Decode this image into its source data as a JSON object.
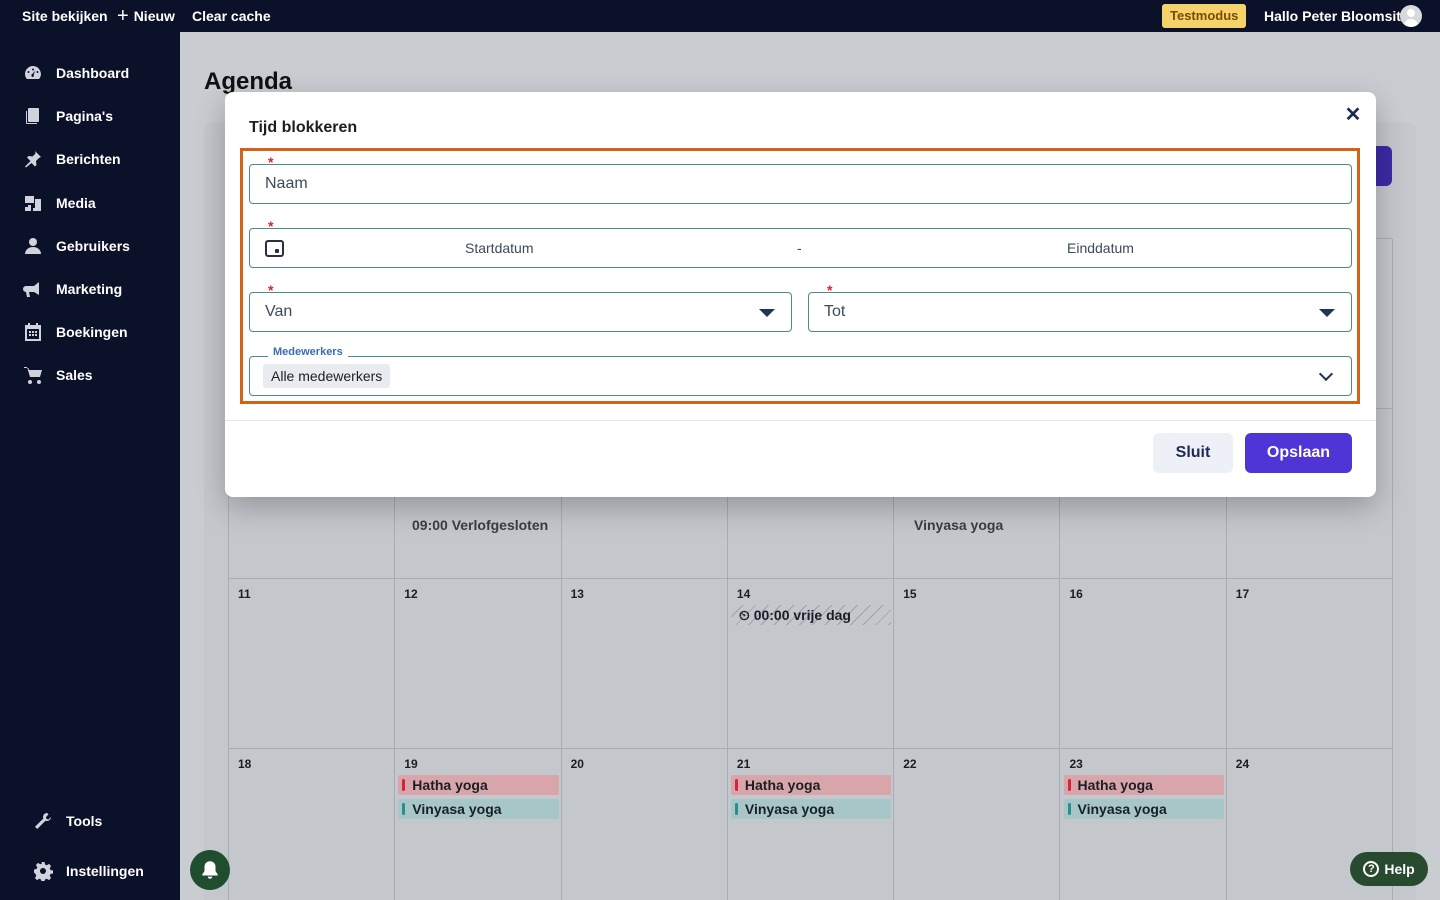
{
  "topbar": {
    "site_label": "Site bekijken",
    "new_label": "Nieuw",
    "cache_label": "Clear cache",
    "mode_badge": "Testmodus",
    "greeting": "Hallo Peter Bloomsite"
  },
  "sidebar": {
    "items": [
      {
        "label": "Dashboard",
        "icon": "dashboard-icon"
      },
      {
        "label": "Pagina's",
        "icon": "pages-icon"
      },
      {
        "label": "Berichten",
        "icon": "pin-icon"
      },
      {
        "label": "Media",
        "icon": "media-icon"
      },
      {
        "label": "Gebruikers",
        "icon": "user-icon"
      },
      {
        "label": "Marketing",
        "icon": "megaphone-icon"
      },
      {
        "label": "Boekingen",
        "icon": "calendar-icon"
      },
      {
        "label": "Sales",
        "icon": "cart-icon"
      }
    ],
    "bottom": [
      {
        "label": "Tools",
        "icon": "wrench-icon"
      },
      {
        "label": "Instellingen",
        "icon": "gear-icon"
      }
    ]
  },
  "page": {
    "title": "Agenda"
  },
  "calendar": {
    "week2": [
      {
        "day": "11",
        "events": []
      },
      {
        "day": "12",
        "events": []
      },
      {
        "day": "13",
        "events": []
      },
      {
        "day": "14",
        "events": [
          {
            "label": "⏲ 00:00 vrije dag",
            "type": "free"
          }
        ]
      },
      {
        "day": "15",
        "events": []
      },
      {
        "day": "16",
        "events": []
      },
      {
        "day": "17",
        "events": []
      }
    ],
    "week3": [
      {
        "day": "18",
        "events": []
      },
      {
        "day": "19",
        "events": [
          {
            "label": "Hatha yoga",
            "type": "hatha"
          },
          {
            "label": "Vinyasa yoga",
            "type": "vinyasa"
          }
        ]
      },
      {
        "day": "20",
        "events": []
      },
      {
        "day": "21",
        "events": [
          {
            "label": "Hatha yoga",
            "type": "hatha"
          },
          {
            "label": "Vinyasa yoga",
            "type": "vinyasa"
          }
        ]
      },
      {
        "day": "22",
        "events": []
      },
      {
        "day": "23",
        "events": [
          {
            "label": "Hatha yoga",
            "type": "hatha"
          },
          {
            "label": "Vinyasa yoga",
            "type": "vinyasa"
          }
        ]
      },
      {
        "day": "24",
        "events": []
      }
    ],
    "cut_texts": [
      "09:00 Verlofgesloten",
      "Vinyasa yoga"
    ]
  },
  "modal": {
    "title": "Tijd blokkeren",
    "required_mark": "*",
    "name_placeholder": "Naam",
    "start_placeholder": "Startdatum",
    "range_separator": "-",
    "end_placeholder": "Einddatum",
    "from_placeholder": "Van",
    "to_placeholder": "Tot",
    "staff_legend": "Medewerkers",
    "staff_chip": "Alle medewerkers",
    "close_label": "Sluit",
    "save_label": "Opslaan"
  },
  "help_label": "Help",
  "colors": {
    "accent": "#4f35d6",
    "highlight": "#d4631a",
    "hatha": "#d2253a",
    "vinyasa": "#2a8c93"
  }
}
